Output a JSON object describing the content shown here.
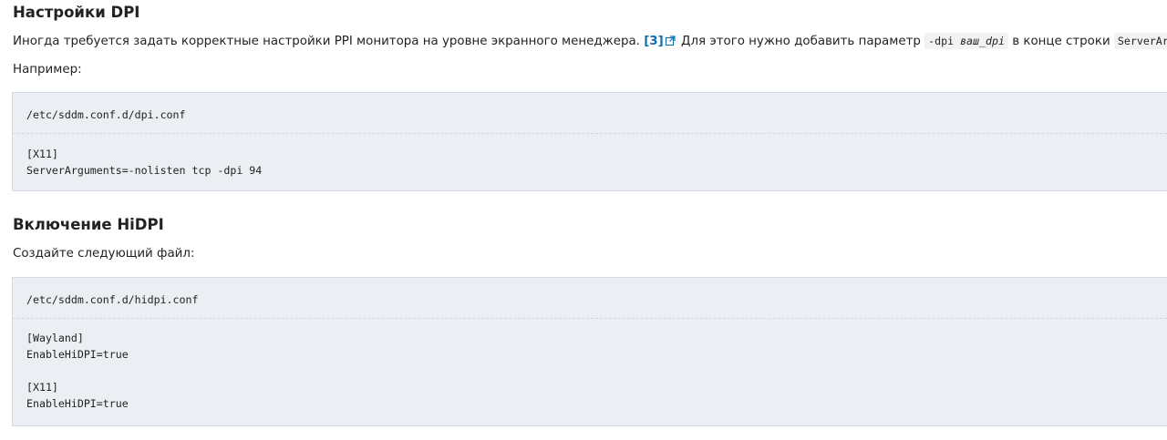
{
  "section1": {
    "heading": "Настройки DPI",
    "para_text_a": "Иногда требуется задать корректные настройки PPI монитора на уровне экранного менеджера.",
    "footnote_ref": "[3]",
    "external_link_icon": "external-link-icon",
    "para_text_b": "Для этого нужно добавить параметр",
    "param_code_prefix": "-dpi",
    "param_code_var": "ваш_dpi",
    "para_text_c": "в конце строки",
    "server_args_code": "ServerArguments",
    "para_text_end": ".",
    "example_label": "Например:",
    "codebox": {
      "filename": "/etc/sddm.conf.d/dpi.conf",
      "content": "[X11]\nServerArguments=-nolisten tcp -dpi 94"
    }
  },
  "section2": {
    "heading": "Включение HiDPI",
    "intro": "Создайте следующий файл:",
    "codebox": {
      "filename": "/etc/sddm.conf.d/hidpi.conf",
      "content": "[Wayland]\nEnableHiDPI=true\n\n[X11]\nEnableHiDPI=true"
    }
  },
  "colors": {
    "link": "#0b6eb0",
    "code_bg": "#ebeef3",
    "code_border": "#d5dbe5",
    "text": "#222222"
  }
}
